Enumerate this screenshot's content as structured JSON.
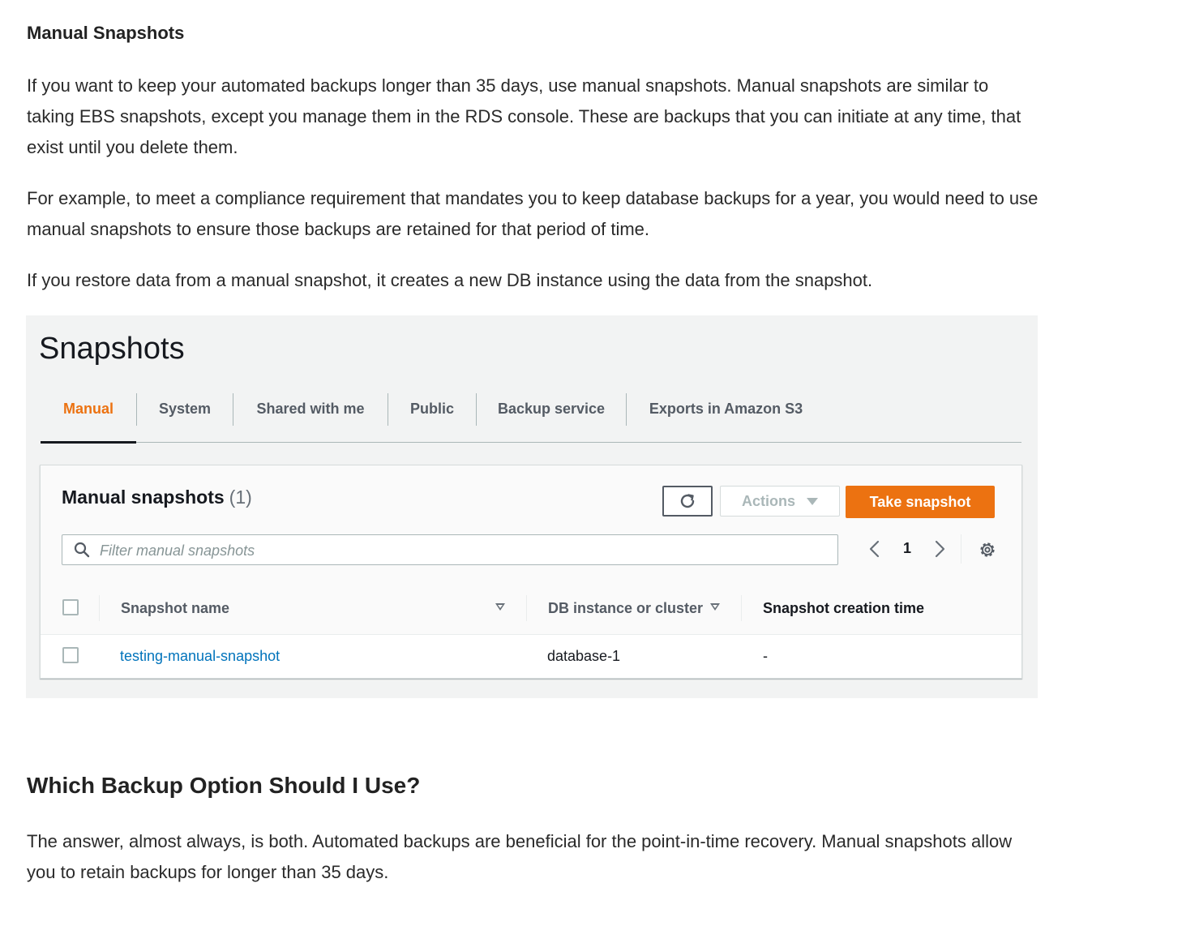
{
  "article": {
    "heading": "Manual Snapshots",
    "paragraph1": "If you want to keep your automated backups longer than 35 days, use manual snapshots. Manual snapshots are similar to taking EBS snapshots, except you manage them in the RDS console. These are backups that you can initiate at any time, that exist until you delete them.",
    "paragraph2": "For example, to meet a compliance requirement that mandates you to keep database backups for a year, you would need to use manual snapshots to ensure those backups are retained for that period of time.",
    "paragraph3": "If you restore data from a manual snapshot, it creates a new DB instance using the data from the snapshot.",
    "heading2": "Which Backup Option Should I Use?",
    "paragraph4": "The answer, almost always, is both. Automated backups are beneficial for the point-in-time recovery. Manual snapshots allow you to retain backups for longer than 35 days."
  },
  "console": {
    "page_title": "Snapshots",
    "tabs": [
      {
        "label": "Manual",
        "active": true
      },
      {
        "label": "System",
        "active": false
      },
      {
        "label": "Shared with me",
        "active": false
      },
      {
        "label": "Public",
        "active": false
      },
      {
        "label": "Backup service",
        "active": false
      },
      {
        "label": "Exports in Amazon S3",
        "active": false
      }
    ],
    "container": {
      "title": "Manual snapshots",
      "count": "(1)",
      "actions_label": "Actions",
      "take_snapshot_label": "Take snapshot",
      "filter_placeholder": "Filter manual snapshots",
      "page_number": "1",
      "columns": [
        "Snapshot name",
        "DB instance or cluster",
        "Snapshot creation time"
      ],
      "rows": [
        {
          "snapshot_name": "testing-manual-snapshot",
          "db_instance": "database-1",
          "creation_time": "-"
        }
      ]
    },
    "colors": {
      "accent": "#ec7211",
      "link": "#0073bb",
      "panel_bg": "#f2f3f3"
    },
    "icons": [
      "refresh-icon",
      "caret-down-icon",
      "search-icon",
      "chevron-left-icon",
      "chevron-right-icon",
      "gear-icon",
      "sort-icon"
    ]
  }
}
